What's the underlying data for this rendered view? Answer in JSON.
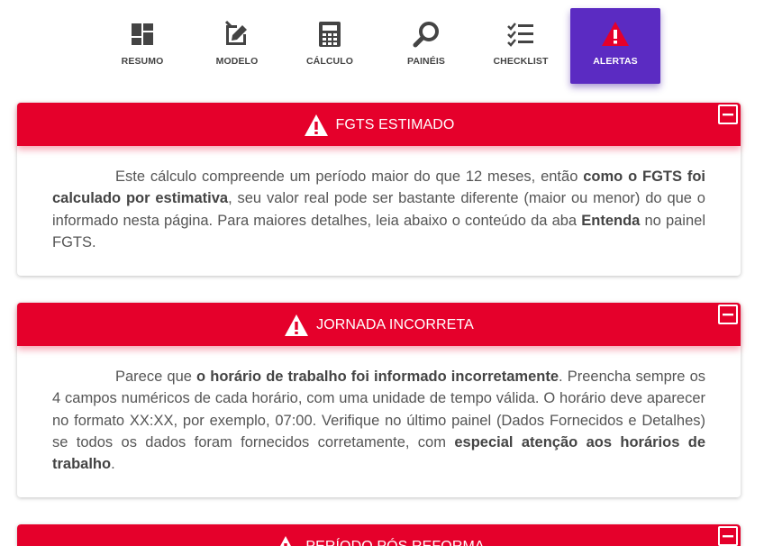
{
  "nav": {
    "items": [
      {
        "label": "RESUMO",
        "icon": "dashboard-icon",
        "active": false
      },
      {
        "label": "MODELO",
        "icon": "edit-box-icon",
        "active": false
      },
      {
        "label": "CÁLCULO",
        "icon": "calculator-icon",
        "active": false
      },
      {
        "label": "PAINÉIS",
        "icon": "search-icon",
        "active": false
      },
      {
        "label": "CHECKLIST",
        "icon": "checklist-icon",
        "active": false
      },
      {
        "label": "ALERTAS",
        "icon": "warning-icon",
        "active": true
      }
    ],
    "active_color": "#5b2bc2"
  },
  "alerts": [
    {
      "title": "FGTS ESTIMADO",
      "segments": [
        "Este cálculo compreende um período maior do que 12 meses, então ",
        "como o FGTS foi calculado por estimativa",
        ", seu valor real pode ser bastante diferente (maior ou menor) do que o informado nesta página. Para maiores detalhes, leia abaixo o conteúdo da aba ",
        "Entenda",
        " no painel FGTS."
      ]
    },
    {
      "title": "JORNADA INCORRETA",
      "segments": [
        "Parece que ",
        "o horário de trabalho foi informado incorretamente",
        ". Preencha sempre os 4 campos numéricos de cada horário, com uma unidade de tempo válida. O horário deve aparecer no formato XX:XX, por exemplo, 07:00. Verifique no último painel (Dados Fornecidos e Detalhes) se todos os dados foram fornecidos corretamente, com ",
        "especial atenção aos horários de trabalho",
        "."
      ]
    },
    {
      "title": "PERÍODO PÓS REFORMA",
      "segments": []
    }
  ],
  "colors": {
    "alert_header": "#e5002b",
    "text": "#555555"
  }
}
